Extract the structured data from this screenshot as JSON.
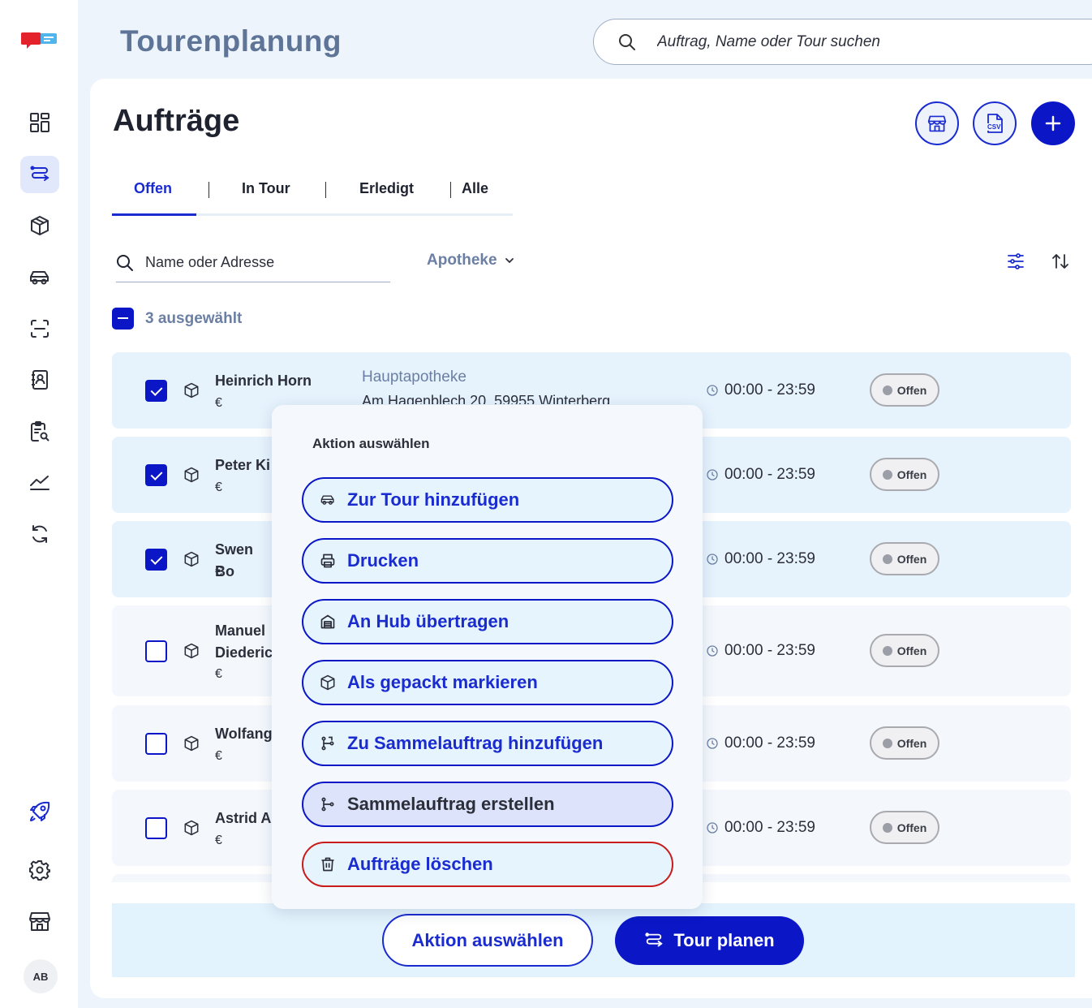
{
  "header": {
    "title": "Tourenplanung",
    "search_placeholder": "Auftrag, Name oder Tour suchen"
  },
  "sidebar": {
    "items": [
      {
        "icon": "dashboard-icon"
      },
      {
        "icon": "route-icon",
        "active": true
      },
      {
        "icon": "package-icon"
      },
      {
        "icon": "car-icon"
      },
      {
        "icon": "scan-icon"
      },
      {
        "icon": "contacts-icon"
      },
      {
        "icon": "clipboard-search-icon"
      },
      {
        "icon": "chart-icon"
      },
      {
        "icon": "sync-icon"
      }
    ],
    "bottom": [
      {
        "icon": "rocket-icon"
      },
      {
        "icon": "gear-icon"
      },
      {
        "icon": "store-icon"
      }
    ],
    "avatar_initials": "AB"
  },
  "main": {
    "title": "Aufträge",
    "header_buttons": [
      {
        "icon": "store-icon"
      },
      {
        "icon": "csv-icon",
        "label": "CSV"
      },
      {
        "icon": "plus-icon"
      }
    ],
    "tabs": [
      {
        "label": "Offen",
        "active": true
      },
      {
        "label": "In Tour"
      },
      {
        "label": "Erledigt"
      },
      {
        "label": "Alle"
      }
    ],
    "filter": {
      "search_placeholder": "Name oder Adresse",
      "pharmacy_select": "Apotheke"
    },
    "selection_text": "3 ausgewählt",
    "orders": [
      {
        "name": "Heinrich Horn",
        "pharmacy": "Hauptapotheke",
        "address": "Am Hagenblech 20, 59955 Winterberg",
        "payment": "€",
        "time": "00:00 - 23:59",
        "status": "Offen",
        "checked": true
      },
      {
        "name": "Peter Ki",
        "payment": "€",
        "time": "00:00 - 23:59",
        "status": "Offen",
        "checked": true
      },
      {
        "name": "Swen Bo",
        "payment": "€",
        "time": "00:00 - 23:59",
        "status": "Offen",
        "checked": true
      },
      {
        "name": "Manuel",
        "name_line2": "Diederic",
        "payment": "€",
        "time": "00:00 - 23:59",
        "status": "Offen",
        "checked": false
      },
      {
        "name": "Wolfang",
        "payment": "€",
        "time": "00:00 - 23:59",
        "status": "Offen",
        "checked": false
      },
      {
        "name": "Astrid A",
        "payment": "€",
        "time": "00:00 - 23:59",
        "status": "Offen",
        "checked": false
      }
    ]
  },
  "popup": {
    "title": "Aktion auswählen",
    "actions": [
      {
        "label": "Zur Tour hinzufügen",
        "icon": "car-icon"
      },
      {
        "label": "Drucken",
        "icon": "printer-icon"
      },
      {
        "label": "An Hub übertragen",
        "icon": "hub-icon"
      },
      {
        "label": "Als gepackt markieren",
        "icon": "package-icon"
      },
      {
        "label": "Zu Sammelauftrag hinzufügen",
        "icon": "merge-icon"
      },
      {
        "label": "Sammelauftrag erstellen",
        "icon": "branch-icon",
        "highlighted": true
      },
      {
        "label": "Aufträge löschen",
        "icon": "trash-icon",
        "danger": true
      }
    ]
  },
  "footer": {
    "action_button": "Aktion auswählen",
    "plan_button": "Tour planen"
  },
  "colors": {
    "primary": "#0b17c7",
    "accent_text": "#1a2bd0",
    "muted_blue": "#6a7fa3",
    "danger": "#c91b1b",
    "selected_row": "#e6f3fd"
  }
}
